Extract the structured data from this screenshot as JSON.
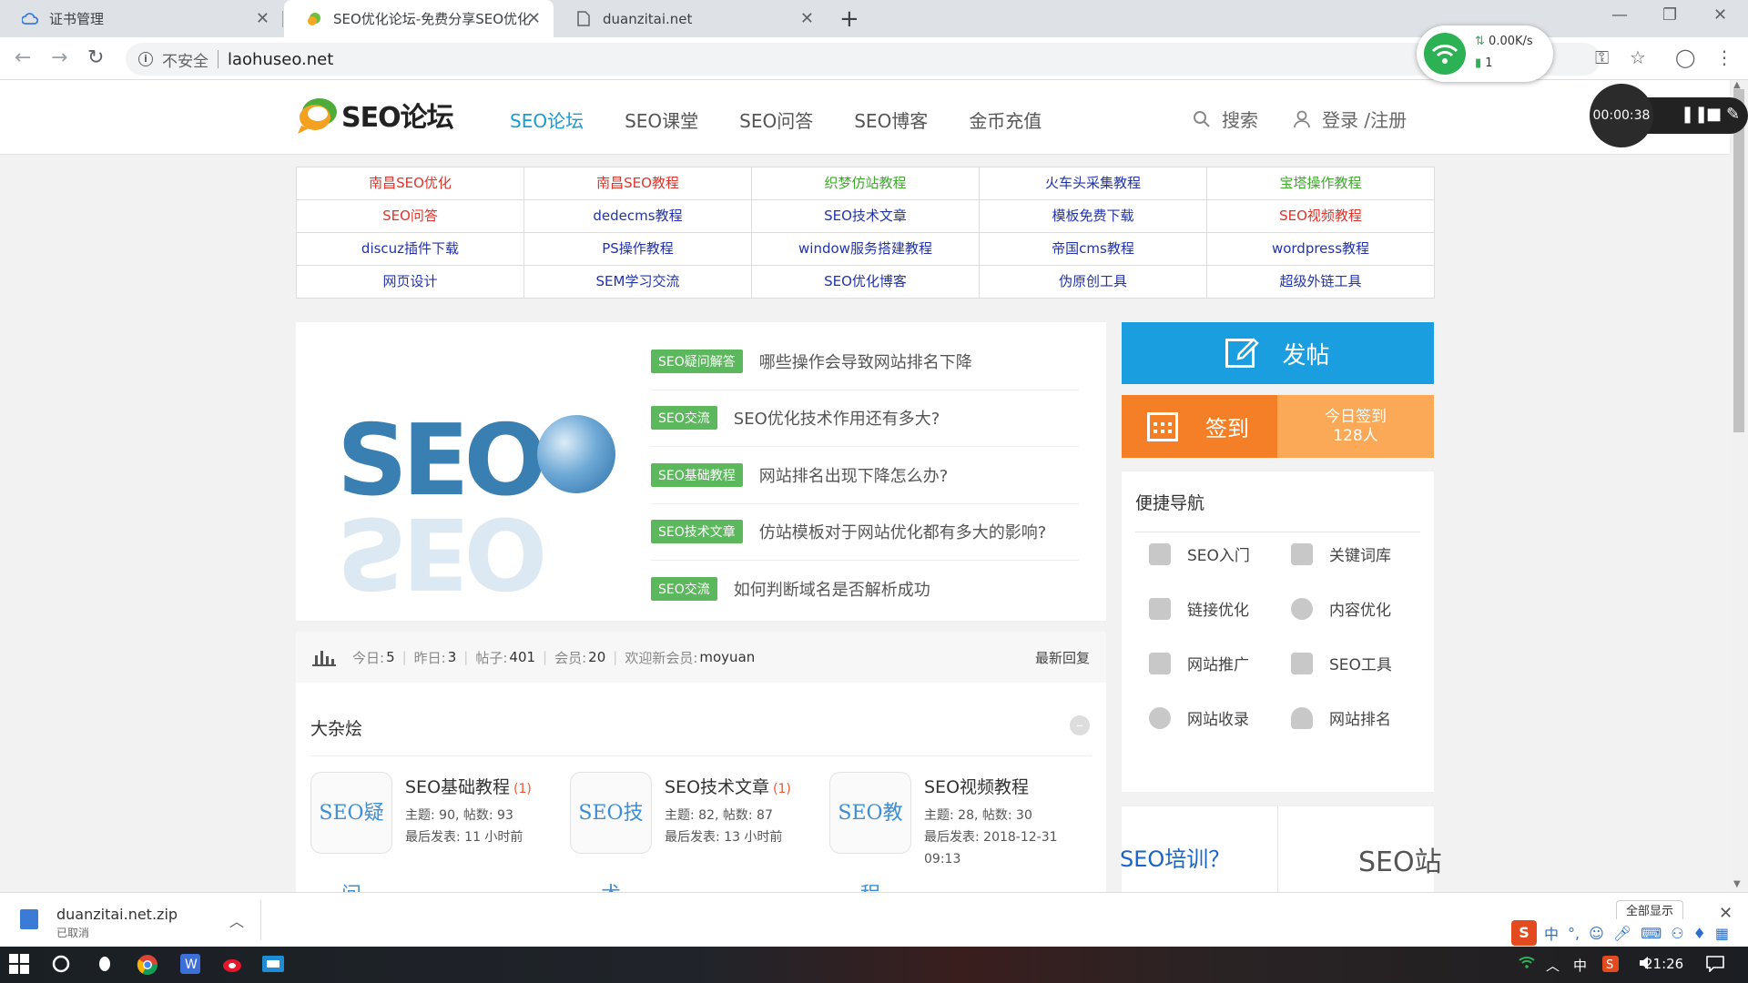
{
  "browser": {
    "tabs": [
      {
        "title": "证书管理",
        "icon": "cloud-icon",
        "active": false
      },
      {
        "title": "SEO优化论坛-免费分享SEO优化",
        "icon": "seo-favicon",
        "active": true
      },
      {
        "title": "duanzitai.net",
        "icon": "document-icon",
        "active": false
      }
    ],
    "security_label": "不安全",
    "url": "laohuseo.net"
  },
  "net_widget": {
    "speed": "0.00K/s",
    "count": "1"
  },
  "recorder": {
    "time": "00:00:38"
  },
  "site": {
    "logo_text": "SEO论坛",
    "nav": [
      "SEO论坛",
      "SEO课堂",
      "SEO问答",
      "SEO博客",
      "金币充值"
    ],
    "search_label": "搜索",
    "login_label": "登录 /注册",
    "quick_links": [
      {
        "label": "南昌SEO优化",
        "color": "#e0332b"
      },
      {
        "label": "南昌SEO教程",
        "color": "#e0332b"
      },
      {
        "label": "织梦仿站教程",
        "color": "#3faa2e"
      },
      {
        "label": "火车头采集教程",
        "color": "#2233aa"
      },
      {
        "label": "宝塔操作教程",
        "color": "#3faa2e"
      },
      {
        "label": "SEO问答",
        "color": "#e0332b"
      },
      {
        "label": "dedecms教程",
        "color": "#2233aa"
      },
      {
        "label": "SEO技术文章",
        "color": "#2233aa"
      },
      {
        "label": "模板免费下载",
        "color": "#2233aa"
      },
      {
        "label": "SEO视频教程",
        "color": "#e0332b"
      },
      {
        "label": "discuz插件下载",
        "color": "#2233aa"
      },
      {
        "label": "PS操作教程",
        "color": "#2233aa"
      },
      {
        "label": "window服务搭建教程",
        "color": "#2233aa"
      },
      {
        "label": "帝国cms教程",
        "color": "#2233aa"
      },
      {
        "label": "wordpress教程",
        "color": "#2233aa"
      },
      {
        "label": "网页设计",
        "color": "#2233aa"
      },
      {
        "label": "SEM学习交流",
        "color": "#2233aa"
      },
      {
        "label": "SEO优化博客",
        "color": "#2233aa"
      },
      {
        "label": "伪原创工具",
        "color": "#2233aa"
      },
      {
        "label": "超级外链工具",
        "color": "#2233aa"
      }
    ],
    "featured": [
      {
        "tag": "SEO疑问解答",
        "title": "哪些操作会导致网站排名下降"
      },
      {
        "tag": "SEO交流",
        "title": "SEO优化技术作用还有多大?"
      },
      {
        "tag": "SEO基础教程",
        "title": "网站排名出现下降怎么办?"
      },
      {
        "tag": "SEO技术文章",
        "title": "仿站模板对于网站优化都有多大的影响?"
      },
      {
        "tag": "SEO交流",
        "title": "如何判断域名是否解析成功"
      }
    ],
    "post_label": "发帖",
    "checkin": {
      "label": "签到",
      "today_line1": "今日签到",
      "today_line2": "128人"
    },
    "quicknav": {
      "title": "便捷导航",
      "items": [
        "SEO入门",
        "关键词库",
        "链接优化",
        "内容优化",
        "网站推广",
        "SEO工具",
        "网站收录",
        "网站排名"
      ]
    },
    "ad": {
      "left": "SEO培训？",
      "right": "SEO站"
    },
    "stats": {
      "today_label": "今日:",
      "today": "5",
      "yesterday_label": "昨日:",
      "yesterday": "3",
      "posts_label": "帖子:",
      "posts": "401",
      "members_label": "会员:",
      "members": "20",
      "newest_label": "欢迎新会员:",
      "newest": "moyuan",
      "latest_reply": "最新回复"
    },
    "section": {
      "title": "大杂烩",
      "boards": [
        {
          "icon_text": "SEO疑问",
          "name": "SEO基础教程",
          "new": "(1)",
          "stat": "主题: 90, 帖数: 93",
          "last": "最后发表: 11 小时前"
        },
        {
          "icon_text": "SEO技术",
          "name": "SEO技术文章",
          "new": "(1)",
          "stat": "主题: 82, 帖数: 87",
          "last": "最后发表: 13 小时前"
        },
        {
          "icon_text": "SEO教程",
          "name": "SEO视频教程",
          "new": "",
          "stat": "主题: 28, 帖数: 30",
          "last": "最后发表: 2018-12-31 09:13"
        }
      ]
    }
  },
  "downloads": {
    "file": "duanzitai.net.zip",
    "status": "已取消",
    "show_all": "全部显示"
  },
  "taskbar": {
    "time": "21:26",
    "ime": "中"
  }
}
